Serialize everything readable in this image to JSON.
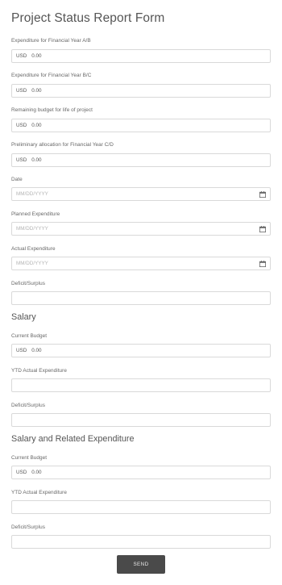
{
  "form": {
    "title": "Project Status Report Form",
    "send_label": "SEND",
    "fields": [
      {
        "label": "Expenditure for Financial Year A/B",
        "currency": "USD",
        "value": "0.00"
      },
      {
        "label": "Expenditure for Financial Year B/C",
        "currency": "USD",
        "value": "0.00"
      },
      {
        "label": "Remaining budget for life of project",
        "currency": "USD",
        "value": "0.00"
      },
      {
        "label": "Preliminary allocation for Financial Year C/D",
        "currency": "USD",
        "value": "0.00"
      },
      {
        "label": "Date",
        "placeholder": "MM/DD/YYYY"
      },
      {
        "label": "Planned Expenditure",
        "placeholder": "MM/DD/YYYY"
      },
      {
        "label": "Actual Expenditure",
        "placeholder": "MM/DD/YYYY"
      },
      {
        "label": "Deficit/Surplus",
        "value": ""
      }
    ],
    "salary": {
      "heading": "Salary",
      "current_budget_label": "Current Budget",
      "current_budget_currency": "USD",
      "current_budget_value": "0.00",
      "ytd_label": "YTD Actual Expenditure",
      "deficit_label": "Deficit/Surplus"
    },
    "salary_related": {
      "heading": "Salary and Related Expenditure",
      "current_budget_label": "Current Budget",
      "current_budget_currency": "USD",
      "current_budget_value": "0.00",
      "ytd_label": "YTD Actual Expenditure",
      "deficit_label": "Deficit/Surplus"
    }
  },
  "icons": {
    "calendar": "calendar-icon"
  }
}
